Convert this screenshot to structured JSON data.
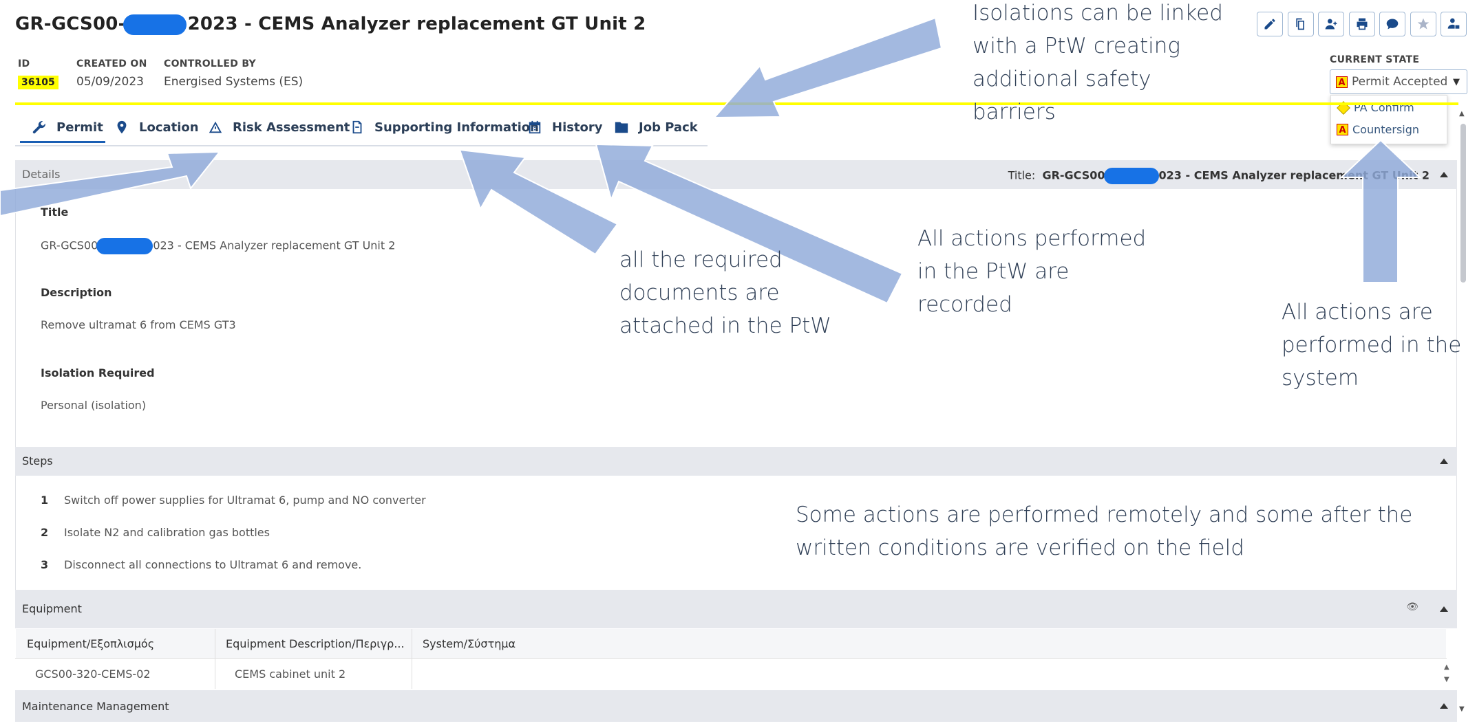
{
  "header": {
    "title_prefix": "GR-GCS00-",
    "title_suffix": "2023 - CEMS Analyzer replacement GT Unit 2",
    "id_label": "ID",
    "id_value": "36105",
    "created_label": "CREATED ON",
    "created_value": "05/09/2023",
    "controlled_label": "CONTROLLED BY",
    "controlled_value": "Energised Systems (ES)"
  },
  "actions": [
    "edit-icon",
    "copy-icon",
    "add-person-icon",
    "print-icon",
    "comment-icon",
    "star-icon",
    "lock-person-icon"
  ],
  "state": {
    "label": "CURRENT STATE",
    "selected": "Permit Accepted",
    "badge": "A",
    "options": [
      {
        "badge": "diamond",
        "label": "PA Confirm"
      },
      {
        "badge": "A",
        "label": "Countersign"
      }
    ]
  },
  "tabs": [
    {
      "label": "Permit",
      "icon": "wrench-icon"
    },
    {
      "label": "Location",
      "icon": "map-pin-icon"
    },
    {
      "label": "Risk Assessment",
      "icon": "risk-icon"
    },
    {
      "label": "Supporting Information",
      "icon": "document-icon"
    },
    {
      "label": "History",
      "icon": "calendar-icon"
    },
    {
      "label": "Job Pack",
      "icon": "folder-icon"
    }
  ],
  "details": {
    "section_title": "Details",
    "title_label": "Title:",
    "title_value_prefix": "GR-GCS00",
    "title_value_suffix": "023 - CEMS Analyzer replacement GT Unit 2",
    "fields": {
      "title_label": "Title",
      "title_value_prefix": "GR-GCS00",
      "title_value_suffix": "023 - CEMS Analyzer replacement GT Unit 2",
      "description_label": "Description",
      "description_value": "Remove ultramat 6 from CEMS GT3",
      "isolation_label": "Isolation Required",
      "isolation_value": "Personal (isolation)"
    }
  },
  "steps": {
    "section_title": "Steps",
    "items": [
      {
        "num": "1",
        "text": "Switch off power supplies for Ultramat 6, pump and NO converter"
      },
      {
        "num": "2",
        "text": "Isolate N2 and calibration gas bottles"
      },
      {
        "num": "3",
        "text": "Disconnect all connections to Ultramat 6 and remove."
      }
    ]
  },
  "equipment": {
    "section_title": "Equipment",
    "columns": [
      "Equipment/Εξοπλισμός",
      "Equipment Description/Περιγρ...",
      "System/Σύστημα"
    ],
    "rows": [
      [
        "GCS00-320-CEMS-02",
        "CEMS cabinet unit 2",
        ""
      ]
    ]
  },
  "maintenance": {
    "section_title": "Maintenance Management"
  },
  "annotations": {
    "isolations": [
      "Isolations can be linked",
      "with a PtW creating",
      "additional safety",
      "barriers"
    ],
    "documents": [
      "all the required",
      "documents are",
      "attached in the PtW"
    ],
    "recorded": [
      "All actions performed",
      "in the PtW are",
      "recorded"
    ],
    "system": [
      "All actions are",
      "performed in the",
      "system"
    ],
    "remote": [
      "Some actions are performed remotely and some after the",
      "written conditions are verified on the field"
    ]
  },
  "colors": {
    "accent": "#1a4a8a",
    "highlight": "#ffff00",
    "arrow": "#8fa9d9"
  }
}
